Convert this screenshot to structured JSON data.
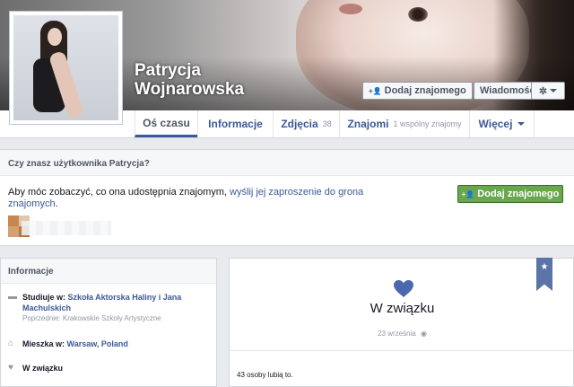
{
  "profile": {
    "first_name": "Patrycja",
    "last_name": "Wojnarowska"
  },
  "cover_actions": {
    "add_friend_label": "Dodaj znajomego",
    "message_label": "Wiadomość",
    "add_friend_icon": "add-friend-icon",
    "settings_icon": "gear-icon"
  },
  "nav": {
    "tabs": [
      {
        "label": "Oś czasu",
        "active": true
      },
      {
        "label": "Informacje"
      },
      {
        "label": "Zdjęcia",
        "count": "38"
      },
      {
        "label": "Znajomi",
        "count": "1 wspólny znajomy"
      },
      {
        "label": "Więcej"
      }
    ]
  },
  "friend_prompt": {
    "title": "Czy znasz użytkownika Patrycja?",
    "text_before": "Aby móc zobaczyć, co ona udostępnia znajomym, ",
    "link": "wyślij jej zaproszenie do grona znajomych",
    "text_after": ".",
    "button_label": "Dodaj znajomego"
  },
  "info": {
    "heading": "Informacje",
    "study_prefix": "Studiuje w: ",
    "study_school": "Szkoła Aktorska Haliny i Jana Machulskich",
    "previous": "Poprzednie: Krakowskie Szkoły Artystyczne",
    "lives_prefix": "Mieszka w: ",
    "lives_city": "Warsaw, Poland",
    "relationship": "W związku"
  },
  "status_card": {
    "relationship": "W związku",
    "date": "23 września",
    "likes": "43 osoby lubią to."
  },
  "colors": {
    "brand": "#3b5998",
    "green_button": "#69a74e",
    "background": "#e9eaed"
  }
}
